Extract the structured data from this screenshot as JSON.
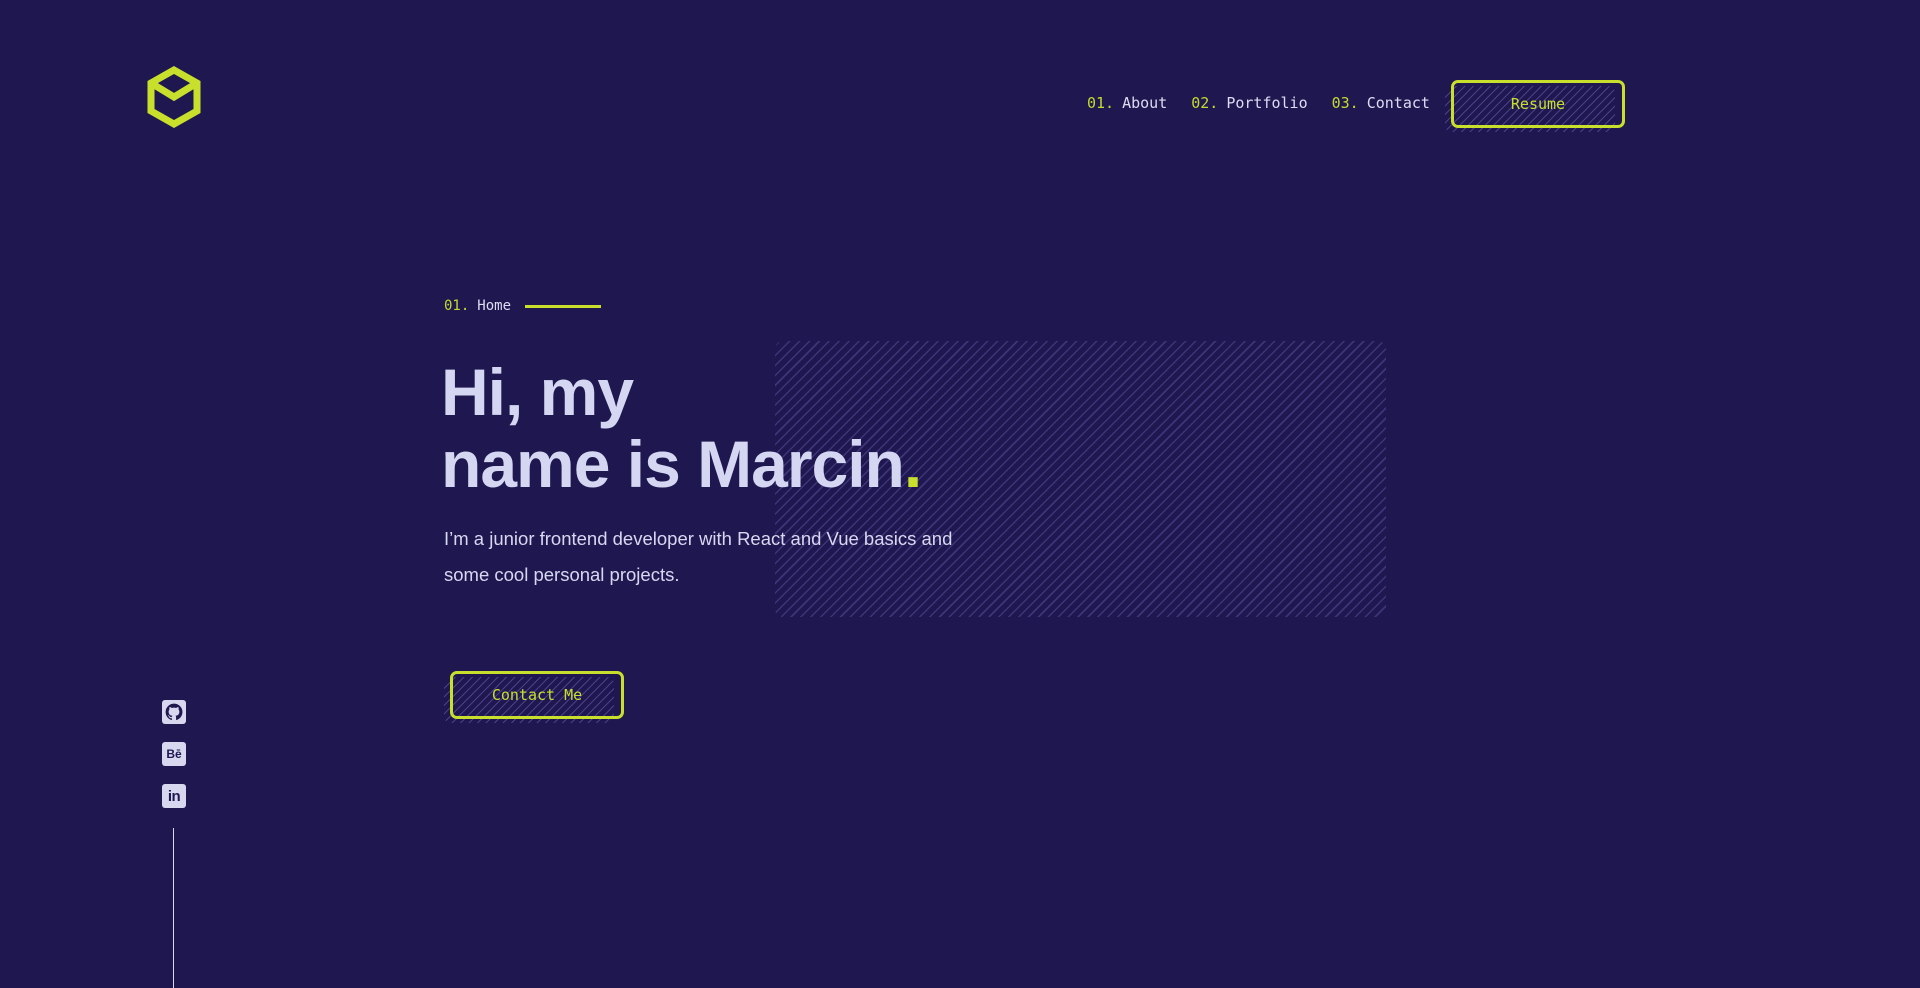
{
  "nav": {
    "items": [
      {
        "num": "01.",
        "label": "About"
      },
      {
        "num": "02.",
        "label": "Portfolio"
      },
      {
        "num": "03.",
        "label": "Contact"
      }
    ],
    "resume_label": "Resume"
  },
  "hero": {
    "section_num": "01.",
    "section_label": "Home",
    "title_line1": "Hi, my",
    "title_line2": "name is Marcin",
    "title_dot": ".",
    "subtitle": "I’m a junior frontend developer with React and Vue basics and some cool personal projects.",
    "cta_label": "Contact Me"
  },
  "socials": [
    {
      "icon": "github-icon"
    },
    {
      "icon": "behance-icon",
      "text": "Bē"
    },
    {
      "icon": "linkedin-icon",
      "text": "in"
    }
  ],
  "colors": {
    "background": "#1f1850",
    "accent": "#c8e02c",
    "text": "#d4d6f2"
  }
}
